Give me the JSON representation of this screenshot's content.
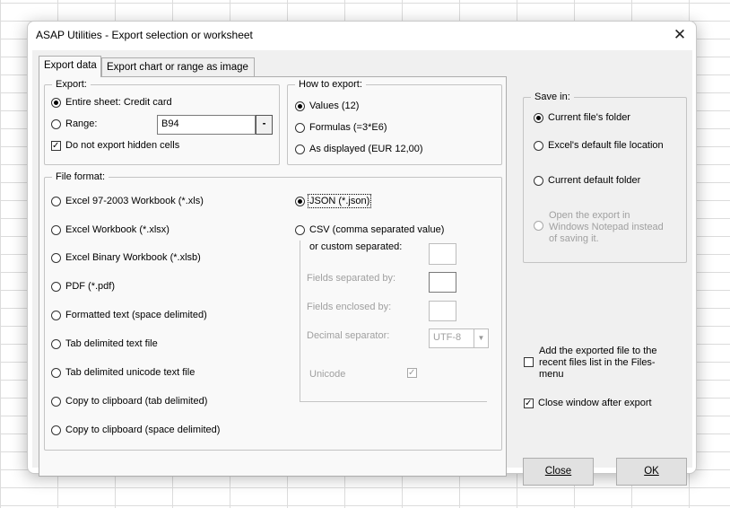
{
  "window": {
    "title": "ASAP Utilities - Export selection or worksheet",
    "close_glyph": "✕"
  },
  "tabs": {
    "export_data": "Export data",
    "export_chart": "Export chart or range as image"
  },
  "export_group": {
    "title": "Export:",
    "entire_sheet": "Entire sheet: Credit card",
    "range_label": "Range:",
    "range_value": "B94",
    "range_button": "-",
    "hidden_cells": "Do not export hidden cells"
  },
  "how_group": {
    "title": "How to export:",
    "values": "Values (12)",
    "formulas": "Formulas (=3*E6)",
    "as_displayed": "As displayed (EUR 12,00)"
  },
  "file_format": {
    "title": "File format:",
    "xls": "Excel 97-2003 Workbook (*.xls)",
    "xlsx": "Excel Workbook (*.xlsx)",
    "xlsb": "Excel Binary Workbook (*.xlsb)",
    "pdf": "PDF (*.pdf)",
    "formatted_text": "Formatted text (space delimited)",
    "tab_text": "Tab delimited text file",
    "tab_unicode": "Tab delimited unicode text file",
    "clip_tab": "Copy to clipboard (tab delimited)",
    "clip_space": "Copy to clipboard (space delimited)",
    "json": "JSON (*.json)",
    "csv": "CSV (comma separated value)",
    "custom_separated": "or custom separated:",
    "fields_separated": "Fields separated by:",
    "fields_enclosed": "Fields enclosed by:",
    "decimal_sep": "Decimal separator:",
    "encoding_value": "UTF-8",
    "unicode": "Unicode"
  },
  "save_in": {
    "title": "Save in:",
    "current_file": "Current file's folder",
    "excel_default": "Excel's default file location",
    "current_default": "Current default folder",
    "notepad_line1": "Open the export in",
    "notepad_line2": "Windows Notepad instead",
    "notepad_line3": "of saving it."
  },
  "add_recent": {
    "line1": "Add the exported file to the",
    "line2": "recent files list in the Files-",
    "line3": "menu"
  },
  "close_after": "Close window after export",
  "buttons": {
    "close": "Close",
    "ok": "OK"
  }
}
